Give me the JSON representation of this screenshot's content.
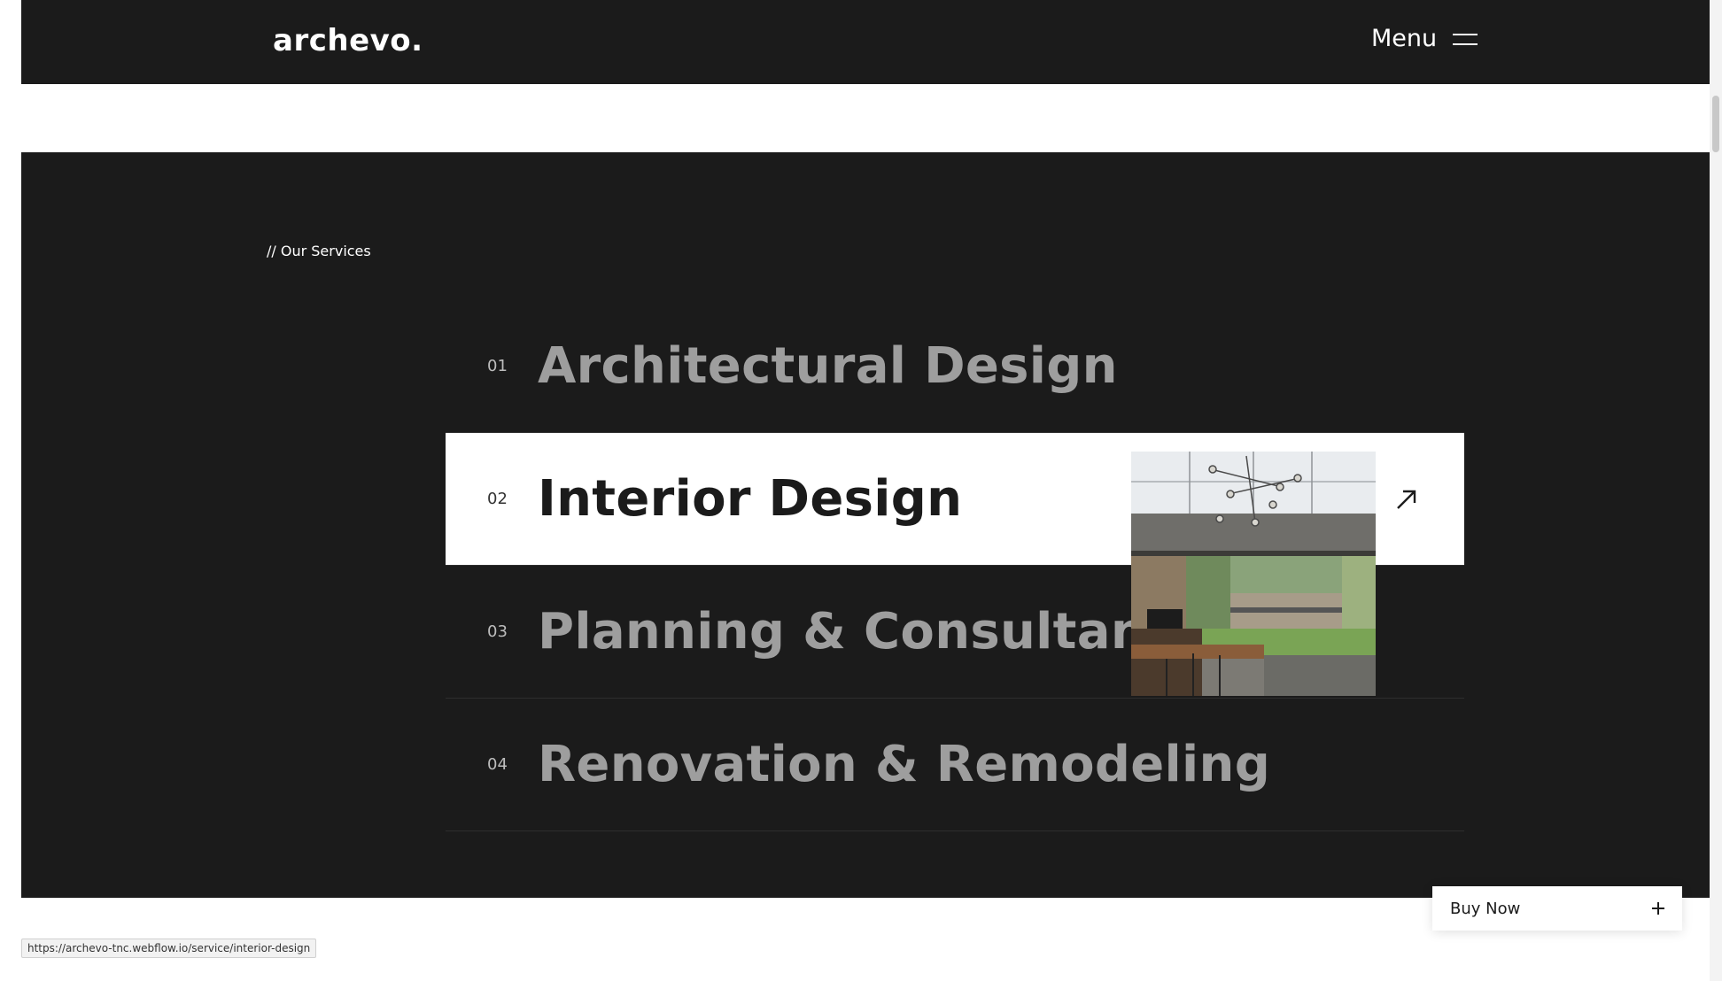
{
  "header": {
    "logo": "archevo.",
    "menu_label": "Menu"
  },
  "services": {
    "eyebrow": "// Our Services",
    "items": [
      {
        "num": "01",
        "title": "Architectural Design"
      },
      {
        "num": "02",
        "title": "Interior Design"
      },
      {
        "num": "03",
        "title": "Planning & Consultancy"
      },
      {
        "num": "04",
        "title": "Renovation & Remodeling"
      }
    ],
    "active_index": 1
  },
  "buy": {
    "label": "Buy Now"
  },
  "status": {
    "url": "https://archevo-tnc.webflow.io/service/interior-design"
  },
  "icons": [
    "menu-icon",
    "arrow-up-right-icon",
    "plus-icon"
  ]
}
